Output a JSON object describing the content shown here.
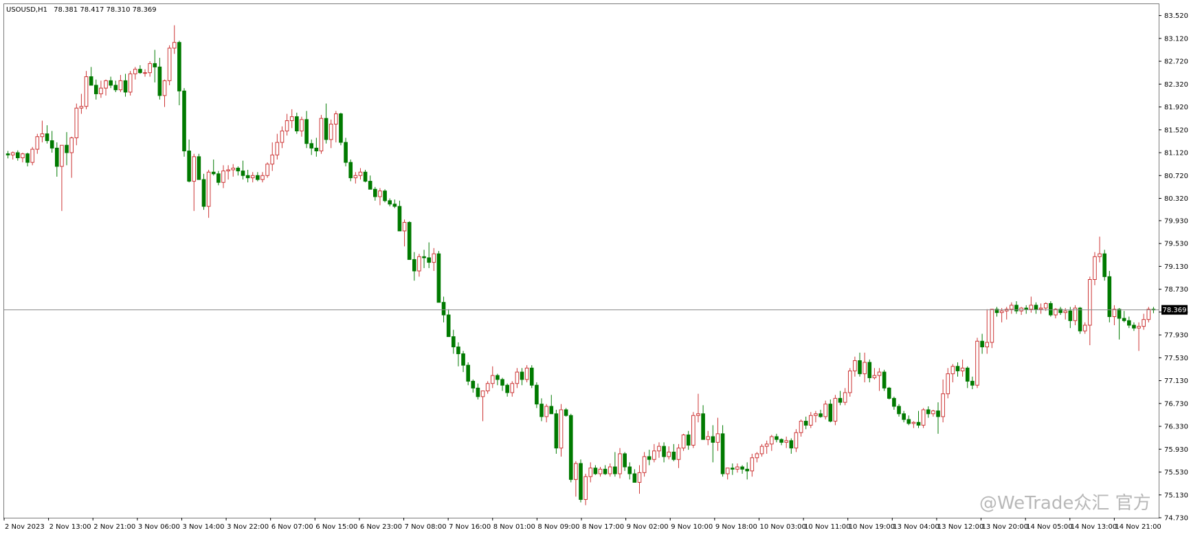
{
  "header": {
    "symbol": "USOUSD,H1",
    "ohlc": "78.381 78.417 78.310 78.369"
  },
  "watermark": "@WeTrade众汇 官方",
  "colors": {
    "bull": "#cc3333",
    "bear": "#007a00",
    "grid_border": "#7a7a7a",
    "price_line": "#8a8a8a",
    "label_bg": "#000000",
    "label_fg": "#ffffff"
  },
  "chart_data": {
    "type": "candlestick",
    "ylim": [
      74.73,
      83.72
    ],
    "y_ticks": [
      "83.520",
      "83.120",
      "82.720",
      "82.320",
      "81.920",
      "81.520",
      "81.120",
      "80.720",
      "80.320",
      "79.930",
      "79.530",
      "79.130",
      "78.730",
      "78.330",
      "77.930",
      "77.530",
      "77.130",
      "76.730",
      "76.330",
      "75.930",
      "75.530",
      "75.130",
      "74.730"
    ],
    "x_ticks": [
      "2 Nov 2023",
      "2 Nov 13:00",
      "2 Nov 21:00",
      "3 Nov 06:00",
      "3 Nov 14:00",
      "3 Nov 22:00",
      "6 Nov 07:00",
      "6 Nov 15:00",
      "6 Nov 23:00",
      "7 Nov 08:00",
      "7 Nov 16:00",
      "8 Nov 01:00",
      "8 Nov 09:00",
      "8 Nov 17:00",
      "9 Nov 02:00",
      "9 Nov 10:00",
      "9 Nov 18:00",
      "10 Nov 03:00",
      "10 Nov 11:00",
      "10 Nov 19:00",
      "13 Nov 04:00",
      "13 Nov 12:00",
      "13 Nov 20:00",
      "14 Nov 05:00",
      "14 Nov 13:00",
      "14 Nov 21:00"
    ],
    "current_price": "78.369",
    "candles": [
      [
        81.1,
        81.15,
        81.02,
        81.08
      ],
      [
        81.08,
        81.14,
        81.0,
        81.12
      ],
      [
        81.12,
        81.16,
        80.98,
        81.03
      ],
      [
        81.03,
        81.12,
        80.95,
        81.1
      ],
      [
        81.1,
        81.12,
        80.88,
        80.95
      ],
      [
        80.95,
        81.22,
        80.9,
        81.18
      ],
      [
        81.18,
        81.45,
        81.1,
        81.4
      ],
      [
        81.4,
        81.68,
        81.3,
        81.45
      ],
      [
        81.45,
        81.6,
        81.28,
        81.33
      ],
      [
        81.33,
        81.5,
        81.12,
        81.2
      ],
      [
        81.2,
        81.3,
        80.7,
        80.88
      ],
      [
        80.88,
        81.25,
        80.1,
        81.25
      ],
      [
        81.25,
        81.48,
        80.9,
        81.12
      ],
      [
        81.12,
        81.4,
        80.68,
        81.38
      ],
      [
        81.38,
        81.98,
        81.25,
        81.9
      ],
      [
        81.9,
        82.15,
        81.8,
        81.93
      ],
      [
        81.93,
        82.55,
        81.88,
        82.45
      ],
      [
        82.45,
        82.62,
        82.3,
        82.3
      ],
      [
        82.3,
        82.4,
        82.05,
        82.15
      ],
      [
        82.15,
        82.38,
        82.08,
        82.25
      ],
      [
        82.25,
        82.4,
        82.12,
        82.38
      ],
      [
        82.38,
        82.45,
        82.25,
        82.3
      ],
      [
        82.3,
        82.38,
        82.18,
        82.22
      ],
      [
        82.22,
        82.48,
        82.18,
        82.38
      ],
      [
        82.38,
        82.5,
        82.1,
        82.18
      ],
      [
        82.18,
        82.55,
        82.12,
        82.5
      ],
      [
        82.5,
        82.62,
        82.4,
        82.58
      ],
      [
        82.58,
        82.65,
        82.5,
        82.52
      ],
      [
        82.52,
        82.58,
        82.45,
        82.52
      ],
      [
        82.52,
        82.72,
        82.45,
        82.68
      ],
      [
        82.68,
        82.92,
        82.35,
        82.62
      ],
      [
        82.62,
        82.78,
        82.05,
        82.12
      ],
      [
        82.12,
        82.4,
        81.92,
        82.38
      ],
      [
        82.38,
        83.0,
        82.3,
        82.95
      ],
      [
        82.95,
        83.35,
        82.85,
        83.05
      ],
      [
        83.05,
        83.08,
        81.95,
        82.2
      ],
      [
        82.2,
        82.25,
        81.05,
        81.15
      ],
      [
        81.15,
        81.35,
        80.6,
        80.62
      ],
      [
        80.62,
        81.1,
        80.1,
        81.05
      ],
      [
        81.05,
        81.1,
        80.7,
        80.65
      ],
      [
        80.65,
        80.75,
        80.12,
        80.18
      ],
      [
        80.18,
        80.82,
        79.98,
        80.78
      ],
      [
        80.78,
        81.0,
        80.72,
        80.75
      ],
      [
        80.75,
        80.8,
        80.55,
        80.6
      ],
      [
        80.6,
        80.9,
        80.5,
        80.8
      ],
      [
        80.8,
        80.9,
        80.65,
        80.82
      ],
      [
        80.82,
        80.92,
        80.7,
        80.85
      ],
      [
        80.85,
        80.88,
        80.72,
        80.8
      ],
      [
        80.8,
        80.98,
        80.65,
        80.72
      ],
      [
        80.72,
        80.82,
        80.6,
        80.68
      ],
      [
        80.68,
        80.78,
        80.6,
        80.72
      ],
      [
        80.72,
        80.78,
        80.62,
        80.65
      ],
      [
        80.65,
        80.78,
        80.6,
        80.72
      ],
      [
        80.72,
        80.95,
        80.68,
        80.92
      ],
      [
        80.92,
        81.3,
        80.8,
        81.08
      ],
      [
        81.08,
        81.45,
        81.0,
        81.3
      ],
      [
        81.3,
        81.58,
        81.2,
        81.5
      ],
      [
        81.5,
        81.8,
        81.42,
        81.68
      ],
      [
        81.68,
        81.88,
        81.55,
        81.75
      ],
      [
        81.75,
        81.82,
        81.45,
        81.5
      ],
      [
        81.5,
        81.75,
        81.4,
        81.7
      ],
      [
        81.7,
        81.85,
        81.2,
        81.28
      ],
      [
        81.28,
        81.35,
        81.08,
        81.2
      ],
      [
        81.2,
        81.38,
        81.05,
        81.15
      ],
      [
        81.15,
        81.78,
        81.1,
        81.72
      ],
      [
        81.72,
        81.98,
        81.28,
        81.35
      ],
      [
        81.35,
        81.7,
        81.2,
        81.62
      ],
      [
        81.62,
        81.85,
        81.3,
        81.8
      ],
      [
        81.8,
        81.82,
        81.25,
        81.3
      ],
      [
        81.3,
        81.38,
        80.88,
        80.95
      ],
      [
        80.95,
        81.0,
        80.62,
        80.68
      ],
      [
        80.68,
        80.78,
        80.58,
        80.72
      ],
      [
        80.72,
        80.85,
        80.65,
        80.78
      ],
      [
        80.78,
        80.82,
        80.6,
        80.62
      ],
      [
        80.62,
        80.72,
        80.52,
        80.48
      ],
      [
        80.48,
        80.52,
        80.28,
        80.35
      ],
      [
        80.35,
        80.5,
        80.2,
        80.45
      ],
      [
        80.45,
        80.48,
        80.25,
        80.28
      ],
      [
        80.28,
        80.32,
        80.18,
        80.22
      ],
      [
        80.22,
        80.3,
        80.15,
        80.18
      ],
      [
        80.18,
        80.28,
        79.85,
        79.75
      ],
      [
        79.75,
        79.95,
        79.48,
        79.9
      ],
      [
        79.9,
        79.92,
        79.25,
        79.25
      ],
      [
        79.25,
        79.38,
        78.88,
        79.05
      ],
      [
        79.05,
        79.35,
        78.95,
        79.3
      ],
      [
        79.3,
        79.42,
        79.1,
        79.28
      ],
      [
        79.28,
        79.55,
        79.1,
        79.2
      ],
      [
        79.2,
        79.45,
        79.05,
        79.35
      ],
      [
        79.35,
        79.4,
        78.5,
        78.5
      ],
      [
        78.5,
        78.6,
        78.15,
        78.28
      ],
      [
        78.28,
        78.38,
        77.9,
        77.9
      ],
      [
        77.9,
        78.02,
        77.6,
        77.72
      ],
      [
        77.72,
        77.8,
        77.38,
        77.6
      ],
      [
        77.6,
        77.65,
        77.28,
        77.4
      ],
      [
        77.4,
        77.45,
        77.05,
        77.12
      ],
      [
        77.12,
        77.15,
        76.92,
        77.0
      ],
      [
        77.0,
        77.08,
        76.8,
        76.85
      ],
      [
        76.85,
        76.95,
        76.42,
        76.95
      ],
      [
        76.95,
        77.12,
        76.9,
        77.08
      ],
      [
        77.08,
        77.38,
        77.0,
        77.22
      ],
      [
        77.22,
        77.25,
        77.05,
        77.15
      ],
      [
        77.15,
        77.18,
        76.95,
        77.05
      ],
      [
        77.05,
        77.08,
        76.85,
        76.92
      ],
      [
        76.92,
        77.12,
        76.85,
        77.08
      ],
      [
        77.08,
        77.35,
        77.0,
        77.28
      ],
      [
        77.28,
        77.35,
        77.05,
        77.15
      ],
      [
        77.15,
        77.4,
        77.1,
        77.35
      ],
      [
        77.35,
        77.4,
        77.0,
        77.05
      ],
      [
        77.05,
        77.1,
        76.65,
        76.72
      ],
      [
        76.72,
        76.82,
        76.42,
        76.5
      ],
      [
        76.5,
        76.72,
        76.4,
        76.68
      ],
      [
        76.68,
        76.88,
        76.55,
        76.55
      ],
      [
        76.55,
        76.62,
        75.85,
        75.95
      ],
      [
        75.95,
        76.72,
        75.8,
        76.62
      ],
      [
        76.62,
        76.65,
        76.5,
        76.52
      ],
      [
        76.52,
        76.55,
        75.35,
        75.4
      ],
      [
        75.4,
        75.72,
        75.1,
        75.68
      ],
      [
        75.68,
        75.75,
        75.0,
        75.05
      ],
      [
        75.05,
        75.5,
        74.95,
        75.45
      ],
      [
        75.45,
        75.7,
        75.35,
        75.6
      ],
      [
        75.6,
        75.65,
        75.48,
        75.5
      ],
      [
        75.5,
        75.62,
        75.45,
        75.58
      ],
      [
        75.58,
        75.65,
        75.48,
        75.5
      ],
      [
        75.5,
        75.68,
        75.45,
        75.62
      ],
      [
        75.62,
        75.88,
        75.45,
        75.5
      ],
      [
        75.5,
        75.95,
        75.42,
        75.85
      ],
      [
        75.85,
        75.88,
        75.55,
        75.62
      ],
      [
        75.62,
        75.7,
        75.4,
        75.5
      ],
      [
        75.5,
        75.58,
        75.35,
        75.35
      ],
      [
        75.35,
        75.65,
        75.15,
        75.52
      ],
      [
        75.52,
        75.88,
        75.45,
        75.8
      ],
      [
        75.8,
        75.92,
        75.65,
        75.75
      ],
      [
        75.75,
        76.02,
        75.7,
        75.9
      ],
      [
        75.9,
        76.05,
        75.78,
        75.98
      ],
      [
        75.98,
        76.05,
        75.7,
        75.8
      ],
      [
        75.8,
        75.98,
        75.75,
        75.88
      ],
      [
        75.88,
        76.02,
        75.72,
        75.75
      ],
      [
        75.75,
        76.02,
        75.6,
        75.95
      ],
      [
        75.95,
        76.2,
        75.9,
        76.18
      ],
      [
        76.18,
        76.25,
        75.92,
        76.0
      ],
      [
        76.0,
        76.58,
        75.95,
        76.52
      ],
      [
        76.52,
        76.9,
        76.4,
        76.55
      ],
      [
        76.55,
        76.7,
        76.12,
        76.1
      ],
      [
        76.1,
        76.25,
        76.0,
        76.15
      ],
      [
        76.15,
        76.35,
        75.7,
        76.05
      ],
      [
        76.05,
        76.48,
        75.9,
        76.2
      ],
      [
        76.2,
        76.35,
        75.45,
        75.5
      ],
      [
        75.5,
        75.6,
        75.4,
        75.6
      ],
      [
        75.6,
        75.68,
        75.48,
        75.58
      ],
      [
        75.58,
        75.68,
        75.52,
        75.62
      ],
      [
        75.62,
        75.65,
        75.5,
        75.58
      ],
      [
        75.58,
        75.7,
        75.4,
        75.55
      ],
      [
        75.55,
        75.85,
        75.45,
        75.78
      ],
      [
        75.78,
        75.88,
        75.7,
        75.85
      ],
      [
        75.85,
        76.02,
        75.8,
        75.98
      ],
      [
        75.98,
        76.08,
        75.85,
        76.02
      ],
      [
        76.02,
        76.18,
        75.9,
        76.15
      ],
      [
        76.15,
        76.2,
        76.05,
        76.1
      ],
      [
        76.1,
        76.12,
        76.0,
        76.05
      ],
      [
        76.05,
        76.15,
        75.95,
        76.08
      ],
      [
        76.08,
        76.12,
        75.85,
        75.95
      ],
      [
        75.95,
        76.28,
        75.88,
        76.22
      ],
      [
        76.22,
        76.45,
        76.15,
        76.42
      ],
      [
        76.42,
        76.5,
        76.28,
        76.35
      ],
      [
        76.35,
        76.58,
        76.3,
        76.52
      ],
      [
        76.52,
        76.6,
        76.4,
        76.55
      ],
      [
        76.55,
        76.62,
        76.48,
        76.5
      ],
      [
        76.5,
        76.78,
        76.45,
        76.72
      ],
      [
        76.72,
        76.8,
        76.4,
        76.42
      ],
      [
        76.42,
        76.88,
        76.35,
        76.82
      ],
      [
        76.82,
        76.95,
        76.7,
        76.75
      ],
      [
        76.75,
        77.0,
        76.7,
        76.92
      ],
      [
        76.92,
        77.35,
        76.85,
        77.3
      ],
      [
        77.3,
        77.55,
        77.2,
        77.48
      ],
      [
        77.48,
        77.62,
        77.2,
        77.25
      ],
      [
        77.25,
        77.62,
        77.1,
        77.45
      ],
      [
        77.45,
        77.5,
        77.1,
        77.18
      ],
      [
        77.18,
        77.35,
        77.15,
        77.22
      ],
      [
        77.22,
        77.35,
        76.95,
        77.28
      ],
      [
        77.28,
        77.32,
        76.95,
        77.0
      ],
      [
        77.0,
        77.02,
        76.8,
        76.82
      ],
      [
        76.82,
        76.85,
        76.62,
        76.68
      ],
      [
        76.68,
        76.72,
        76.5,
        76.55
      ],
      [
        76.55,
        76.6,
        76.4,
        76.45
      ],
      [
        76.45,
        76.52,
        76.35,
        76.38
      ],
      [
        76.38,
        76.42,
        76.3,
        76.4
      ],
      [
        76.4,
        76.6,
        76.3,
        76.35
      ],
      [
        76.35,
        76.65,
        76.3,
        76.62
      ],
      [
        76.62,
        76.68,
        76.48,
        76.55
      ],
      [
        76.55,
        76.62,
        76.5,
        76.6
      ],
      [
        76.6,
        76.75,
        76.2,
        76.5
      ],
      [
        76.5,
        77.15,
        76.4,
        76.9
      ],
      [
        76.9,
        77.35,
        76.82,
        77.25
      ],
      [
        77.25,
        77.42,
        77.1,
        77.38
      ],
      [
        77.38,
        77.45,
        77.2,
        77.3
      ],
      [
        77.3,
        77.5,
        77.2,
        77.35
      ],
      [
        77.35,
        77.38,
        77.0,
        77.12
      ],
      [
        77.12,
        77.2,
        76.98,
        77.05
      ],
      [
        77.05,
        77.88,
        77.0,
        77.82
      ],
      [
        77.82,
        77.95,
        77.6,
        77.72
      ],
      [
        77.72,
        78.38,
        77.6,
        77.8
      ],
      [
        77.8,
        78.38,
        77.7,
        78.38
      ],
      [
        78.38,
        78.42,
        78.25,
        78.32
      ],
      [
        78.32,
        78.4,
        78.15,
        78.35
      ],
      [
        78.35,
        78.42,
        78.2,
        78.38
      ],
      [
        78.38,
        78.5,
        78.3,
        78.45
      ],
      [
        78.45,
        78.52,
        78.3,
        78.35
      ],
      [
        78.35,
        78.42,
        78.28,
        78.4
      ],
      [
        78.4,
        78.45,
        78.3,
        78.38
      ],
      [
        78.38,
        78.6,
        78.32,
        78.45
      ],
      [
        78.45,
        78.5,
        78.3,
        78.38
      ],
      [
        78.38,
        78.48,
        78.3,
        78.4
      ],
      [
        78.4,
        78.5,
        78.35,
        78.48
      ],
      [
        78.48,
        78.52,
        78.25,
        78.28
      ],
      [
        78.28,
        78.4,
        78.22,
        78.38
      ],
      [
        78.38,
        78.42,
        78.28,
        78.32
      ],
      [
        78.32,
        78.4,
        78.2,
        78.35
      ],
      [
        78.35,
        78.42,
        78.05,
        78.18
      ],
      [
        78.18,
        78.45,
        78.1,
        78.4
      ],
      [
        78.4,
        78.42,
        77.95,
        78.0
      ],
      [
        78.0,
        78.15,
        77.95,
        78.1
      ],
      [
        78.1,
        78.95,
        77.75,
        78.9
      ],
      [
        78.9,
        79.38,
        78.8,
        79.3
      ],
      [
        79.3,
        79.65,
        79.2,
        79.35
      ],
      [
        79.35,
        79.42,
        78.88,
        78.95
      ],
      [
        78.95,
        79.05,
        78.15,
        78.25
      ],
      [
        78.25,
        78.45,
        78.1,
        78.38
      ],
      [
        78.38,
        78.4,
        77.85,
        78.22
      ],
      [
        78.22,
        78.35,
        78.15,
        78.18
      ],
      [
        78.18,
        78.25,
        78.05,
        78.1
      ],
      [
        78.1,
        78.15,
        78.0,
        78.05
      ],
      [
        78.05,
        78.15,
        77.65,
        78.08
      ],
      [
        78.08,
        78.3,
        78.02,
        78.2
      ],
      [
        78.2,
        78.42,
        78.15,
        78.38
      ],
      [
        78.38,
        78.42,
        78.31,
        78.37
      ]
    ]
  }
}
